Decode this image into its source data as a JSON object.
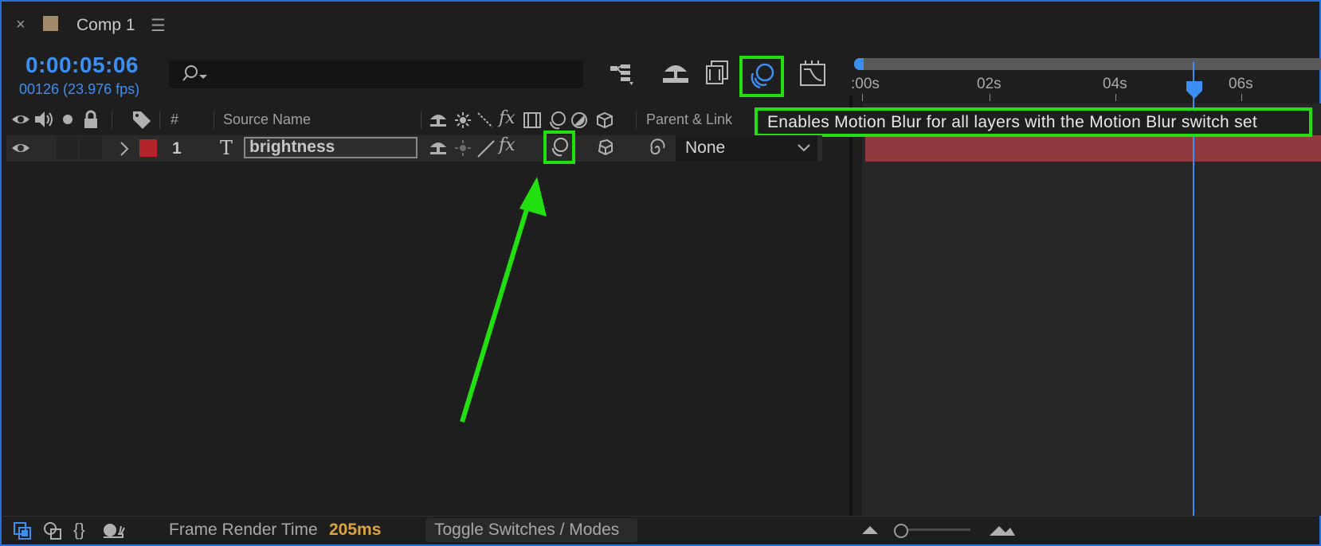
{
  "panel": {
    "close_glyph": "×",
    "title": "Comp 1",
    "menu_glyph": "☰",
    "swatch_color": "#a08a6a"
  },
  "time": {
    "timecode": "0:00:05:06",
    "frames": "00126 (23.976 fps)"
  },
  "search": {
    "placeholder": ""
  },
  "toolbar": {
    "icons": [
      "composition-flowchart-icon",
      "draft-3d-icon",
      "frame-blending-icon",
      "motion-blur-master-icon",
      "graph-editor-icon"
    ],
    "active": "motion-blur-master-icon"
  },
  "ruler": {
    "labels": [
      ":00s",
      "02s",
      "04s",
      "06s"
    ],
    "current_time_seconds": 5.25
  },
  "columns": {
    "number": "#",
    "source_name": "Source Name",
    "parent_link": "Parent & Link"
  },
  "layer": {
    "number": "1",
    "type_glyph": "T",
    "name": "brightness",
    "label_color": "#b4252b",
    "parent": "None"
  },
  "tooltip": {
    "text": "Enables Motion Blur for all layers with the Motion Blur switch set"
  },
  "footer": {
    "frame_render_label": "Frame Render Time",
    "frame_render_value": "205ms",
    "toggle_label": "Toggle Switches / Modes"
  },
  "colors": {
    "accent": "#3b8ff2",
    "highlight": "#22e00f",
    "layer_bar": "#8f3a3f",
    "render_value": "#d9a441"
  }
}
